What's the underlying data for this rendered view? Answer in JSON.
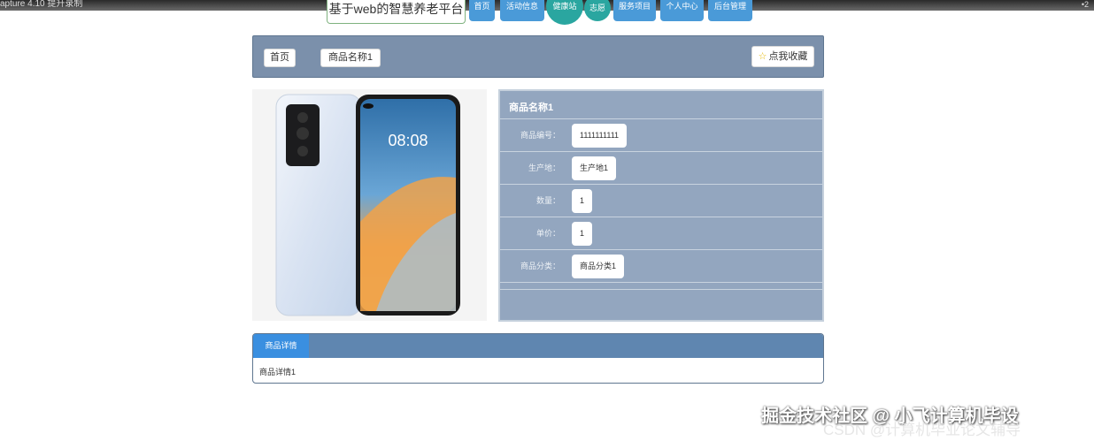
{
  "player": {
    "caption": "apture 4.10 提升录制",
    "corner": "•2"
  },
  "site": {
    "title": "基于web的智慧养老平台"
  },
  "nav": {
    "items": [
      "首页",
      "活动信息",
      "健康站",
      "志愿",
      "服务项目",
      "个人中心",
      "后台管理"
    ]
  },
  "breadcrumb": {
    "home": "首页",
    "current": "商品名称1"
  },
  "favorite": {
    "label": "点我收藏",
    "icon": "star-icon"
  },
  "product": {
    "name": "商品名称1",
    "image": {
      "screen_time": "08:08",
      "icon": "phone-image"
    },
    "fields": [
      {
        "label": "商品编号：",
        "value": "1111111111"
      },
      {
        "label": "生产地：",
        "value": "生产地1"
      },
      {
        "label": "数量：",
        "value": "1"
      },
      {
        "label": "单价：",
        "value": "1"
      },
      {
        "label": "商品分类：",
        "value": "商品分类1"
      }
    ]
  },
  "details": {
    "tab": "商品详情",
    "text": "商品详情1"
  },
  "watermark": {
    "line1": "掘金技术社区 @ 小飞计算机毕设",
    "line2": "CSDN @计算机毕业论文辅导"
  },
  "colors": {
    "panel": "#93a6bf",
    "crumb_bar": "#7b90ab",
    "nav": "#4a9ad8",
    "tab_active": "#3a8fe0"
  }
}
